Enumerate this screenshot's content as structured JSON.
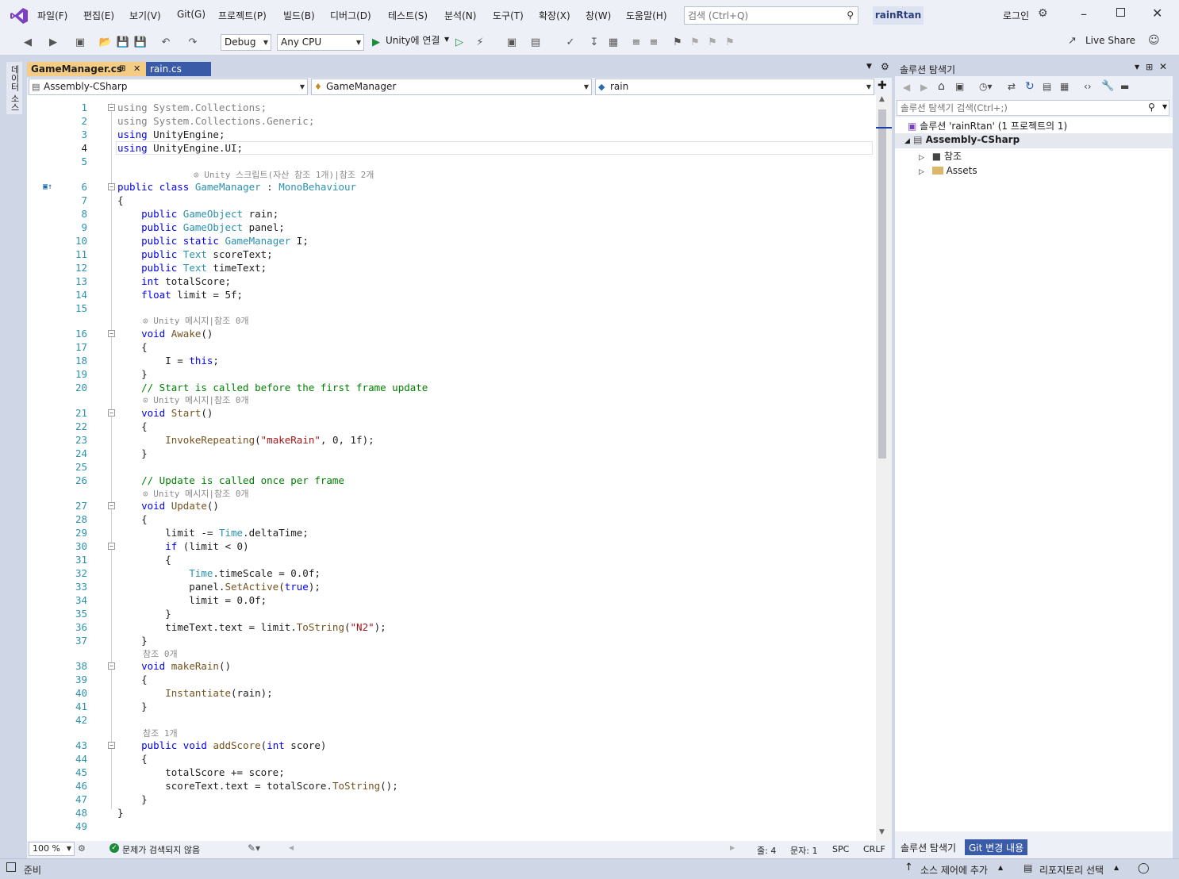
{
  "menu": [
    "파일(F)",
    "편집(E)",
    "보기(V)",
    "Git(G)",
    "프로젝트(P)",
    "빌드(B)",
    "디버그(D)",
    "테스트(S)",
    "분석(N)",
    "도구(T)",
    "확장(X)",
    "창(W)",
    "도움말(H)"
  ],
  "search": {
    "placeholder": "검색 (Ctrl+Q)"
  },
  "solution_name": "rainRtan",
  "login": "로그인",
  "toolbar": {
    "config": "Debug",
    "platform": "Any CPU",
    "run_label": "Unity에 연결",
    "live_share": "Live Share"
  },
  "left_strip": {
    "label": "데이터 소스"
  },
  "tabs": [
    {
      "label": "GameManager.cs"
    },
    {
      "label": "rain.cs"
    }
  ],
  "navbar": {
    "project": "Assembly-CSharp",
    "type": "GameManager",
    "member": "rain"
  },
  "code_lines": [
    {
      "n": "1",
      "t": "using System.Collections;"
    },
    {
      "n": "2",
      "t": "using System.Collections.Generic;"
    },
    {
      "n": "3",
      "t": "using UnityEngine;"
    },
    {
      "n": "4",
      "t": "using UnityEngine.UI;"
    },
    {
      "n": "5",
      "t": ""
    },
    {
      "n": "6",
      "t": "public class GameManager : MonoBehaviour"
    },
    {
      "n": "7",
      "t": "{"
    },
    {
      "n": "8",
      "t": "    public GameObject rain;"
    },
    {
      "n": "9",
      "t": "    public GameObject panel;"
    },
    {
      "n": "10",
      "t": "    public static GameManager I;"
    },
    {
      "n": "11",
      "t": "    public Text scoreText;"
    },
    {
      "n": "12",
      "t": "    public Text timeText;"
    },
    {
      "n": "13",
      "t": "    int totalScore;"
    },
    {
      "n": "14",
      "t": "    float limit = 5f;"
    },
    {
      "n": "15",
      "t": ""
    },
    {
      "n": "16",
      "t": "    void Awake()"
    },
    {
      "n": "17",
      "t": "    {"
    },
    {
      "n": "18",
      "t": "        I = this;"
    },
    {
      "n": "19",
      "t": "    }"
    },
    {
      "n": "20",
      "t": "    // Start is called before the first frame update"
    },
    {
      "n": "21",
      "t": "    void Start()"
    },
    {
      "n": "22",
      "t": "    {"
    },
    {
      "n": "23",
      "t": "        InvokeRepeating(\"makeRain\", 0, 1f);"
    },
    {
      "n": "24",
      "t": "    }"
    },
    {
      "n": "25",
      "t": ""
    },
    {
      "n": "26",
      "t": "    // Update is called once per frame"
    },
    {
      "n": "27",
      "t": "    void Update()"
    },
    {
      "n": "28",
      "t": "    {"
    },
    {
      "n": "29",
      "t": "        limit -= Time.deltaTime;"
    },
    {
      "n": "30",
      "t": "        if (limit < 0)"
    },
    {
      "n": "31",
      "t": "        {"
    },
    {
      "n": "32",
      "t": "            Time.timeScale = 0.0f;"
    },
    {
      "n": "33",
      "t": "            panel.SetActive(true);"
    },
    {
      "n": "34",
      "t": "            limit = 0.0f;"
    },
    {
      "n": "35",
      "t": "        }"
    },
    {
      "n": "36",
      "t": "        timeText.text = limit.ToString(\"N2\");"
    },
    {
      "n": "37",
      "t": "    }"
    },
    {
      "n": "38",
      "t": "    void makeRain()"
    },
    {
      "n": "39",
      "t": "    {"
    },
    {
      "n": "40",
      "t": "        Instantiate(rain);"
    },
    {
      "n": "41",
      "t": "    }"
    },
    {
      "n": "42",
      "t": ""
    },
    {
      "n": "43",
      "t": "    public void addScore(int score)"
    },
    {
      "n": "44",
      "t": "    {"
    },
    {
      "n": "45",
      "t": "        totalScore += score;"
    },
    {
      "n": "46",
      "t": "        scoreText.text = totalScore.ToString();"
    },
    {
      "n": "47",
      "t": "    }"
    },
    {
      "n": "48",
      "t": "}"
    },
    {
      "n": "49",
      "t": ""
    }
  ],
  "codelens": {
    "class": "Unity 스크립트(자산 참조 1개)|참조 2개",
    "awake": "Unity 메시지|참조 0개",
    "start": "Unity 메시지|참조 0개",
    "update": "Unity 메시지|참조 0개",
    "makerain": "참조 0개",
    "addscore": "참조 1개"
  },
  "editor_status": {
    "zoom": "100 %",
    "issues": "문제가 검색되지 않음",
    "line": "줄: 4",
    "col": "문자: 1",
    "spc": "SPC",
    "eol": "CRLF"
  },
  "solution_explorer": {
    "title": "솔루션 탐색기",
    "search_placeholder": "솔루션 탐색기 검색(Ctrl+;)",
    "solution": "솔루션 'rainRtan' (1 프로젝트의 1)",
    "project": "Assembly-CSharp",
    "items": [
      "참조",
      "Assets"
    ],
    "bottom_tabs": [
      "솔루션 탐색기",
      "Git 변경 내용"
    ]
  },
  "statusbar": {
    "ready": "준비",
    "source_control": "소스 제어에 추가",
    "repo": "리포지토리 선택"
  }
}
